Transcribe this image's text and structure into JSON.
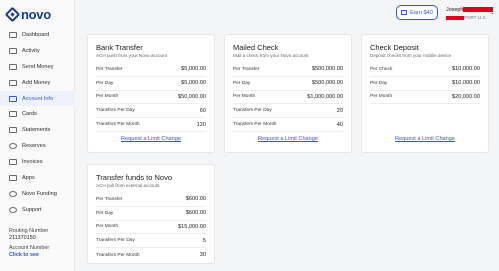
{
  "app": {
    "logo_text": "novo"
  },
  "sidebar": {
    "items": [
      {
        "label": "Dashboard",
        "icon": "dashboard-icon"
      },
      {
        "label": "Activity",
        "icon": "activity-icon"
      },
      {
        "label": "Send Money",
        "icon": "send-icon"
      },
      {
        "label": "Add Money",
        "icon": "add-money-icon"
      },
      {
        "label": "Account Info",
        "icon": "account-icon"
      },
      {
        "label": "Cards",
        "icon": "card-icon"
      },
      {
        "label": "Statements",
        "icon": "statements-icon"
      },
      {
        "label": "Reserves",
        "icon": "reserves-icon"
      },
      {
        "label": "Invoices",
        "icon": "invoice-icon"
      },
      {
        "label": "Apps",
        "icon": "apps-icon"
      },
      {
        "label": "Novo Funding",
        "icon": "funding-icon"
      },
      {
        "label": "Support",
        "icon": "support-icon"
      }
    ],
    "active": "Account Info",
    "routing_label": "Routing Number",
    "routing_value": "211370150",
    "account_label": "Account Number",
    "account_link": "Click to see"
  },
  "header": {
    "earn_label": "Earn $40",
    "user_name": "Joseph",
    "user_sub": "PORT LLC"
  },
  "cards": {
    "bank": {
      "title": "Bank Transfer",
      "subtitle": "ACH push from your Novo account",
      "rows": [
        {
          "label": "Per Transfer",
          "value": "$5,000.00"
        },
        {
          "label": "Per Day",
          "value": "$5,000.00"
        },
        {
          "label": "Per Month",
          "value": "$50,000.00"
        },
        {
          "label": "Transfers Per Day",
          "value": "60"
        },
        {
          "label": "Transfers Per Month",
          "value": "120"
        }
      ],
      "link": "Request a Limit Change"
    },
    "check": {
      "title": "Mailed Check",
      "subtitle": "Mail a check from your Novo account",
      "rows": [
        {
          "label": "Per Transfer",
          "value": "$500,000.00"
        },
        {
          "label": "Per Day",
          "value": "$500,000.00"
        },
        {
          "label": "Per Month",
          "value": "$1,000,000.00"
        },
        {
          "label": "Transfers Per Day",
          "value": "20"
        },
        {
          "label": "Transfers Per Month",
          "value": "40"
        }
      ],
      "link": "Request a Limit Change"
    },
    "deposit": {
      "title": "Check Deposit",
      "subtitle": "Deposit checks from your mobile device",
      "rows": [
        {
          "label": "Per Check",
          "value": "$10,000.00"
        },
        {
          "label": "Per Day",
          "value": "$10,000.00"
        },
        {
          "label": "Per Month",
          "value": "$20,000.00"
        }
      ],
      "link": "Request a Limit Change"
    },
    "transfer_in": {
      "title": "Transfer funds to Novo",
      "subtitle": "ACH pull from external account",
      "rows": [
        {
          "label": "Per Transfer",
          "value": "$600.00"
        },
        {
          "label": "Per Day",
          "value": "$600.00"
        },
        {
          "label": "Per Month",
          "value": "$15,000.00"
        },
        {
          "label": "Transfers Per Day",
          "value": "5"
        },
        {
          "label": "Transfers Per Month",
          "value": "30"
        }
      ]
    }
  },
  "colors": {
    "accent": "#2d5bd1",
    "brand": "#1a3a8f",
    "redaction": "#e0001b"
  }
}
